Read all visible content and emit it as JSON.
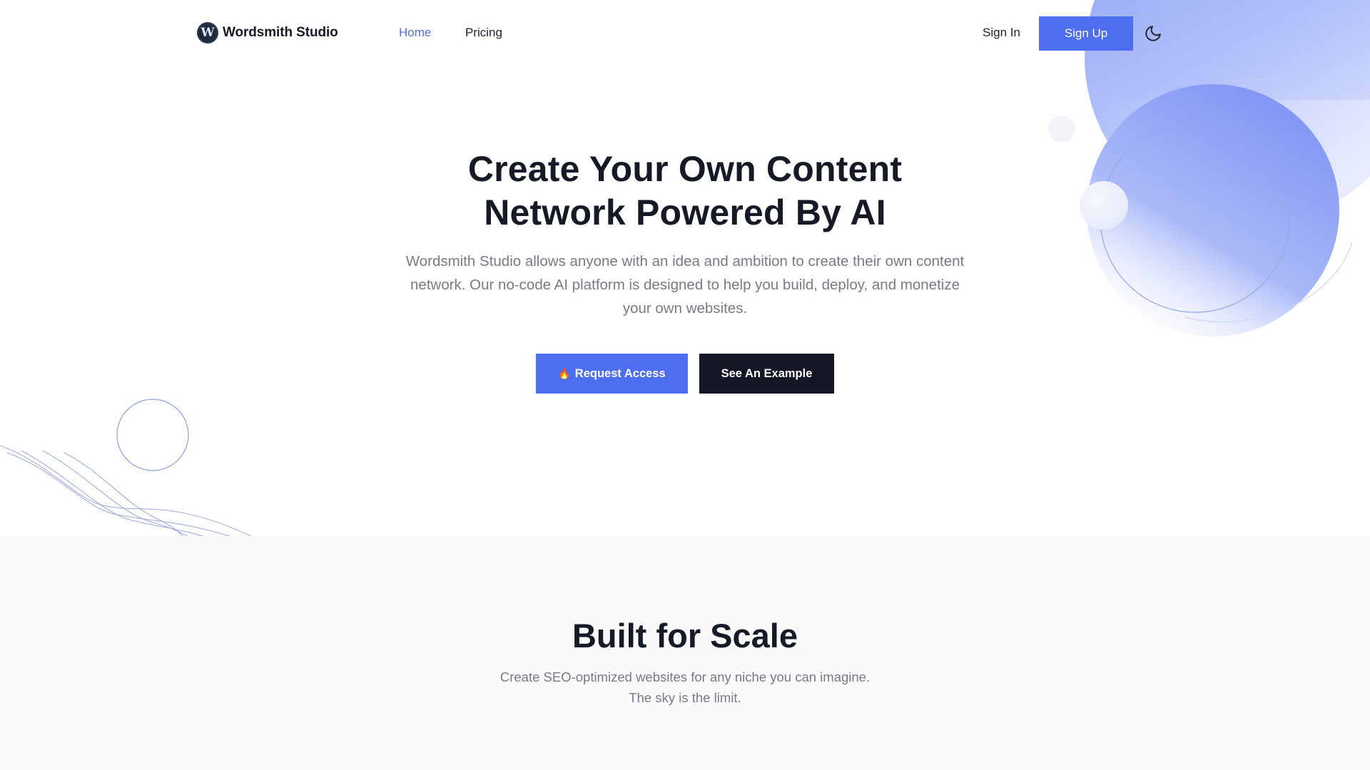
{
  "nav": {
    "brand_name": "Wordsmith Studio",
    "logo_letter": "W",
    "links": [
      {
        "label": "Home",
        "active": true
      },
      {
        "label": "Pricing",
        "active": false
      }
    ],
    "sign_in_label": "Sign In",
    "sign_up_label": "Sign Up",
    "theme_toggle_icon": "moon-icon"
  },
  "hero": {
    "title_line1": "Create Your Own Content",
    "title_line2": "Network Powered By AI",
    "subtitle": "Wordsmith Studio allows anyone with an idea and ambition to create their own content network. Our no-code AI platform is designed to help you build, deploy, and monetize your own websites.",
    "primary_button_icon": "🔥",
    "primary_button_label": "Request Access",
    "secondary_button_label": "See An Example"
  },
  "scale_section": {
    "title": "Built for Scale",
    "subtitle_line1": "Create SEO-optimized websites for any niche you can imagine.",
    "subtitle_line2": "The sky is the limit."
  },
  "colors": {
    "accent": "#4d6ef0",
    "dark": "#141824",
    "active_link": "#5370c9",
    "muted_text": "#767b86",
    "section_bg": "#fafafa"
  }
}
